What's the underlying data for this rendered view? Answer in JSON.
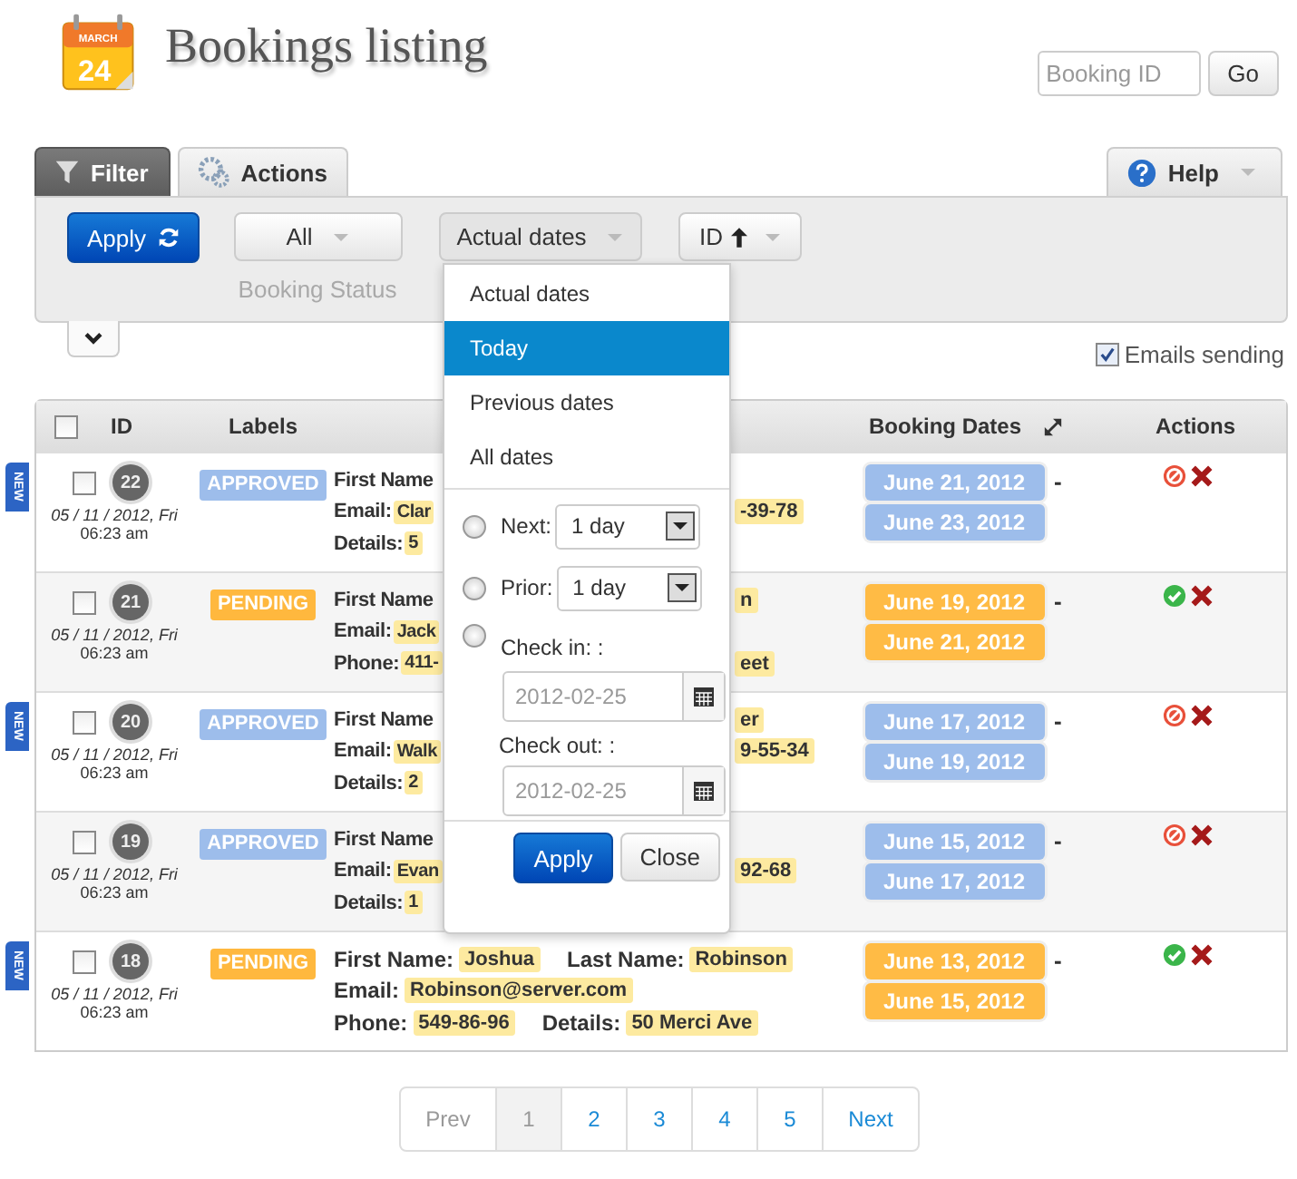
{
  "header": {
    "logo": {
      "month": "MARCH",
      "day": "24"
    },
    "title": "Bookings listing",
    "search": {
      "placeholder": "Booking ID"
    },
    "go_button": "Go"
  },
  "tabs": [
    {
      "label": "Filter",
      "selected": true,
      "kind": "filter"
    },
    {
      "label": "Actions",
      "selected": false,
      "kind": "actions"
    }
  ],
  "help_tab": {
    "label": "Help"
  },
  "filter": {
    "apply_button": "Apply",
    "status_dropdown": {
      "value": "All",
      "caption": "Booking Status"
    },
    "dates_dropdown": {
      "value": "Actual dates",
      "expanded": true
    },
    "sort_dropdown": {
      "value": "ID"
    }
  },
  "dates_menu": {
    "items": [
      {
        "label": "Actual dates",
        "selected": false
      },
      {
        "label": "Today",
        "selected": true
      },
      {
        "label": "Previous dates",
        "selected": false
      },
      {
        "label": "All dates",
        "selected": false
      }
    ],
    "next": {
      "label": "Next:",
      "value": "1 day",
      "selected": false
    },
    "prior": {
      "label": "Prior:",
      "value": "1 day",
      "selected": false
    },
    "check_in": {
      "label": "Check in: :",
      "placeholder": "2012-02-25",
      "selected": false
    },
    "check_out": {
      "label": "Check out: :",
      "placeholder": "2012-02-25"
    },
    "apply_button": "Apply",
    "close_button": "Close"
  },
  "emails_sending": {
    "label": "Emails sending",
    "checked": true
  },
  "table": {
    "select_all": {
      "checked": false
    },
    "columns": [
      "ID",
      "Labels",
      "Booking Dates",
      "Actions"
    ],
    "rows": [
      {
        "id": "22",
        "new_ribbon": "NEW",
        "checked": false,
        "date": "05 / 11 / 2012, Fri",
        "time": "06:23 am",
        "status": "APPROVED",
        "approved": true,
        "lines": [
          {
            "left": [
              {
                "kind": "label",
                "text": "First Name"
              }
            ]
          },
          {
            "left": [
              {
                "kind": "label",
                "text": "Email:"
              },
              {
                "kind": "value",
                "text": "Clar"
              }
            ],
            "right": [
              {
                "kind": "value",
                "text": "-39-78"
              }
            ]
          },
          {
            "left": [
              {
                "kind": "label",
                "text": "Details:"
              },
              {
                "kind": "value",
                "text": "5"
              }
            ]
          }
        ],
        "dates": [
          "June 21, 2012",
          "June 23, 2012"
        ],
        "dash": "-"
      },
      {
        "id": "21",
        "checked": false,
        "date": "05 / 11 / 2012, Fri",
        "time": "06:23 am",
        "status": "PENDING",
        "approved": false,
        "lines": [
          {
            "left": [
              {
                "kind": "label",
                "text": "First Name"
              }
            ],
            "right": [
              {
                "kind": "value",
                "text": "n"
              }
            ]
          },
          {
            "left": [
              {
                "kind": "label",
                "text": "Email:"
              },
              {
                "kind": "value",
                "text": "Jack"
              }
            ]
          },
          {
            "left": [
              {
                "kind": "label",
                "text": "Phone:"
              },
              {
                "kind": "value",
                "text": "411-"
              }
            ],
            "right": [
              {
                "kind": "value",
                "text": "eet"
              }
            ]
          }
        ],
        "dates": [
          "June 19, 2012",
          "June 21, 2012"
        ],
        "dash": "-"
      },
      {
        "id": "20",
        "new_ribbon": "NEW",
        "checked": false,
        "date": "05 / 11 / 2012, Fri",
        "time": "06:23 am",
        "status": "APPROVED",
        "approved": true,
        "lines": [
          {
            "left": [
              {
                "kind": "label",
                "text": "First Name"
              }
            ],
            "right": [
              {
                "kind": "value",
                "text": "er"
              }
            ]
          },
          {
            "left": [
              {
                "kind": "label",
                "text": "Email:"
              },
              {
                "kind": "value",
                "text": "Walk"
              }
            ],
            "right": [
              {
                "kind": "value",
                "text": "9-55-34"
              }
            ]
          },
          {
            "left": [
              {
                "kind": "label",
                "text": "Details:"
              },
              {
                "kind": "value",
                "text": "2"
              }
            ]
          }
        ],
        "dates": [
          "June 17, 2012",
          "June 19, 2012"
        ],
        "dash": "-"
      },
      {
        "id": "19",
        "checked": false,
        "date": "05 / 11 / 2012, Fri",
        "time": "06:23 am",
        "status": "APPROVED",
        "approved": true,
        "lines": [
          {
            "left": [
              {
                "kind": "label",
                "text": "First Name"
              }
            ]
          },
          {
            "left": [
              {
                "kind": "label",
                "text": "Email:"
              },
              {
                "kind": "value",
                "text": "Evan"
              }
            ],
            "right": [
              {
                "kind": "value",
                "text": "92-68"
              }
            ]
          },
          {
            "left": [
              {
                "kind": "label",
                "text": "Details:"
              },
              {
                "kind": "value",
                "text": "1"
              }
            ]
          }
        ],
        "dates": [
          "June 15, 2012",
          "June 17, 2012"
        ],
        "dash": "-"
      },
      {
        "id": "18",
        "new_ribbon": "NEW",
        "checked": false,
        "date": "05 / 11 / 2012, Fri",
        "time": "06:23 am",
        "status": "PENDING",
        "approved": false,
        "lines": [
          {
            "left": [
              {
                "kind": "label",
                "text": "First Name:"
              },
              {
                "kind": "value",
                "text": "Joshua"
              },
              {
                "kind": "label",
                "text": "Last Name:"
              },
              {
                "kind": "value",
                "text": "Robinson"
              }
            ]
          },
          {
            "left": [
              {
                "kind": "label",
                "text": "Email:"
              },
              {
                "kind": "value",
                "text": "Robinson@server.com"
              }
            ]
          },
          {
            "left": [
              {
                "kind": "label",
                "text": "Phone:"
              },
              {
                "kind": "value",
                "text": "549-86-96"
              },
              {
                "kind": "label",
                "text": "Details:"
              },
              {
                "kind": "value",
                "text": "50 Merci Ave"
              }
            ]
          }
        ],
        "dates": [
          "June 13, 2012",
          "June 15, 2012"
        ],
        "dash": "-"
      }
    ]
  },
  "pagination": {
    "prev": "Prev",
    "pages": [
      {
        "label": "1",
        "selected": true
      },
      {
        "label": "2",
        "selected": false
      },
      {
        "label": "3",
        "selected": false
      },
      {
        "label": "4",
        "selected": false
      },
      {
        "label": "5",
        "selected": false
      }
    ],
    "next": "Next"
  }
}
